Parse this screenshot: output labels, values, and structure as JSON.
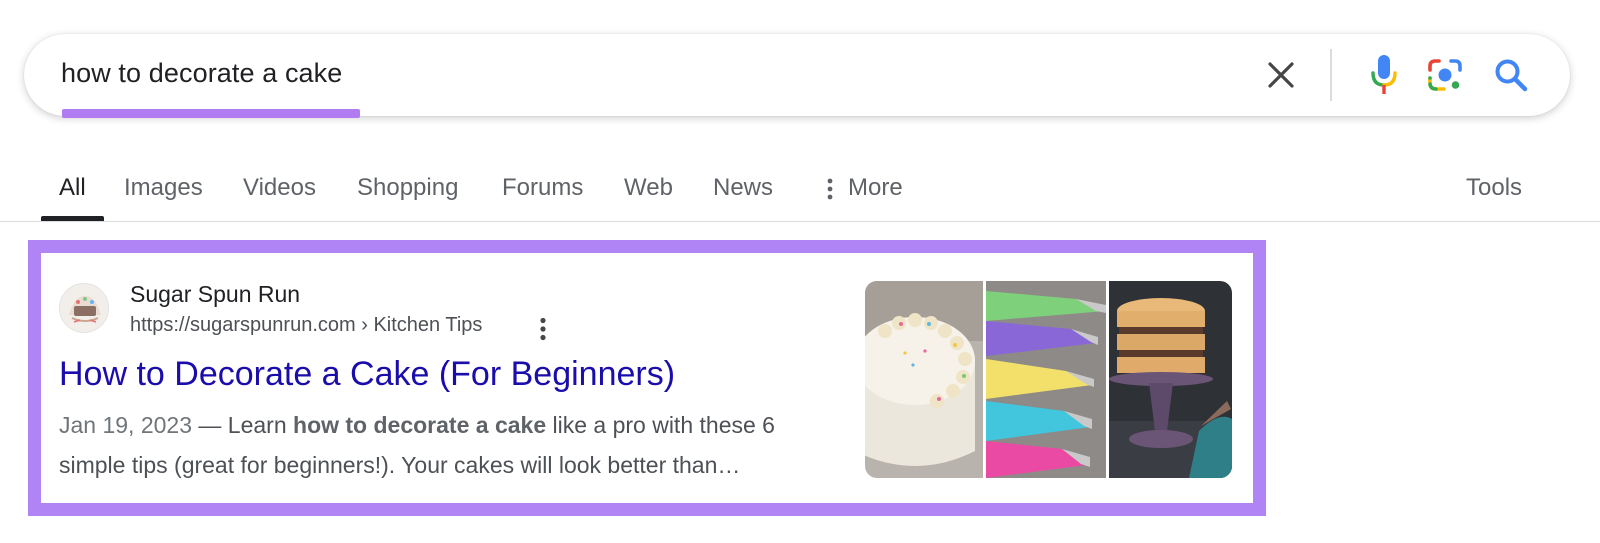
{
  "search": {
    "query": "how to decorate a cake",
    "icons": [
      "close-icon",
      "mic-icon",
      "lens-icon",
      "search-icon"
    ],
    "accent_underline_color": "#b17cf2"
  },
  "tabs": [
    {
      "label": "All",
      "active": true
    },
    {
      "label": "Images"
    },
    {
      "label": "Videos"
    },
    {
      "label": "Shopping"
    },
    {
      "label": "Forums"
    },
    {
      "label": "Web"
    },
    {
      "label": "News"
    },
    {
      "label": "More"
    }
  ],
  "tools_label": "Tools",
  "result": {
    "highlight_color": "#b084f5",
    "site_name": "Sugar Spun Run",
    "url": "https://sugarspunrun.com › Kitchen Tips",
    "title": "How to Decorate a Cake (For Beginners)",
    "title_color": "#1a0dab",
    "date": "Jan 19, 2023",
    "snippet_pre": "Learn ",
    "snippet_bold": "how to decorate a cake",
    "snippet_post": " like a pro with these 6 simple tips (great for beginners!). Your cakes will look better than…",
    "thumbnails": [
      "frosted-cake-image",
      "piping-bags-image",
      "layer-cake-stand-image"
    ]
  }
}
